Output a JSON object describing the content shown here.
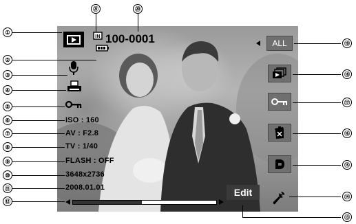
{
  "screen": {
    "file_number": "100-0001",
    "info": {
      "iso": "ISO : 160",
      "av": "AV : F2.8",
      "tv": "TV : 1/40",
      "flash": "FLASH : OFF",
      "resolution": "3648x2736",
      "date": "2008.01.01"
    },
    "all_button_label": "ALL",
    "edit_button_label": "Edit",
    "progress_fraction": 0.48
  },
  "callouts": {
    "left": [
      "①",
      "②",
      "③",
      "④",
      "⑤",
      "⑥",
      "⑦",
      "⑧",
      "⑨",
      "⑩",
      "⑪",
      "⑫"
    ],
    "bottom": "⑬",
    "right": [
      "⑲",
      "⑱",
      "⑰",
      "⑯",
      "⑮",
      "⑭"
    ],
    "top": [
      "㉑",
      "⑳"
    ]
  },
  "icons": {
    "play_mode": "play-icon",
    "memory": "memory-card-icon",
    "battery": "battery-icon",
    "voice_memo": "microphone-icon",
    "dpof": "printer-icon",
    "protect": "key-icon",
    "slideshow": "slideshow-icon",
    "protect_btn": "key-icon",
    "delete": "trash-icon",
    "rotate": "rotate-icon",
    "settings": "wrench-icon"
  }
}
